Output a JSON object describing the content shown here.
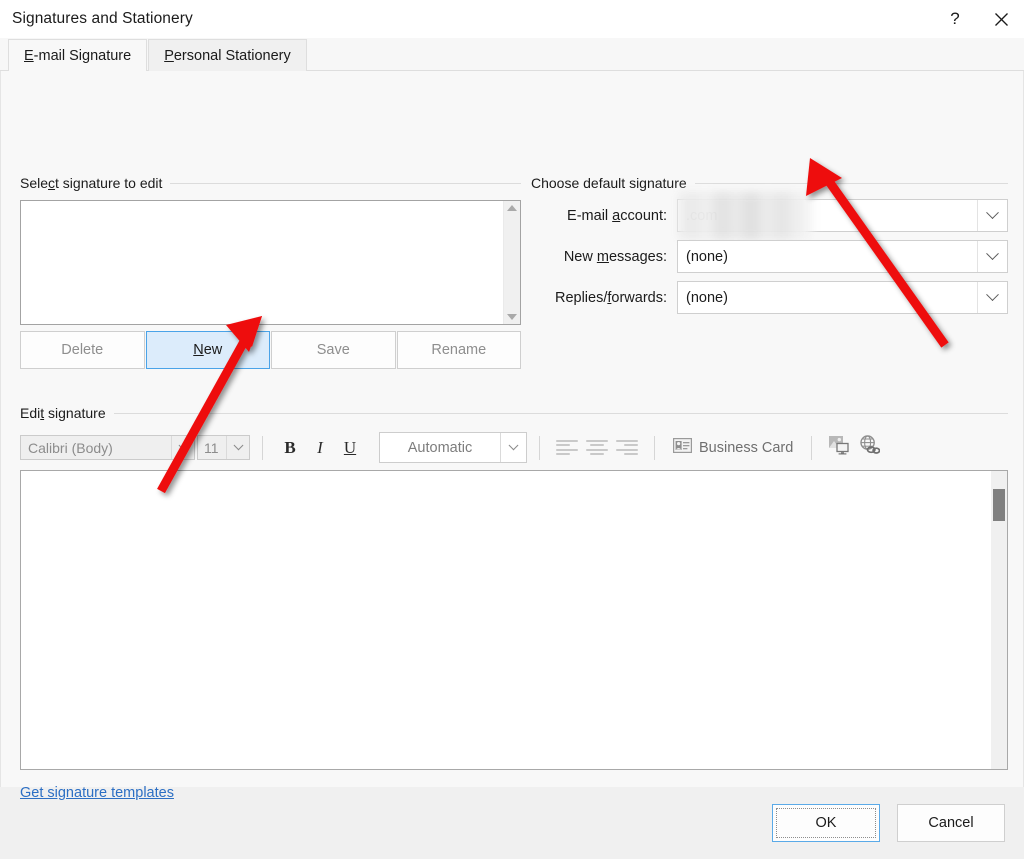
{
  "window": {
    "title": "Signatures and Stationery",
    "help_button": "?",
    "close_button": "✕"
  },
  "tabs": [
    {
      "label_pre": "E",
      "label_acc": "",
      "label": "E-mail Signature",
      "accel": "E",
      "active": true
    },
    {
      "label": "Personal Stationery",
      "accel": "P",
      "active": false
    }
  ],
  "select_signature": {
    "group_label": "Select signature to edit",
    "group_label_accel": "c",
    "list_items": [],
    "buttons": [
      {
        "label": "Delete",
        "state": "disabled"
      },
      {
        "label": "New",
        "accel": "N",
        "state": "highlighted"
      },
      {
        "label": "Save",
        "state": "disabled"
      },
      {
        "label": "Rename",
        "state": "disabled"
      }
    ]
  },
  "default_signature": {
    "group_label": "Choose default signature",
    "fields": [
      {
        "label": "E-mail account:",
        "accel": "a",
        "value": ".com",
        "redacted": true
      },
      {
        "label": "New messages:",
        "accel": "m",
        "value": "(none)",
        "redacted": false
      },
      {
        "label": "Replies/forwards:",
        "accel": "f",
        "value": "(none)",
        "redacted": false
      }
    ]
  },
  "edit_signature": {
    "group_label": "Edit signature",
    "group_label_accel": "t",
    "toolbar": {
      "font_family": "Calibri (Body)",
      "font_size": "11",
      "bold": "B",
      "italic": "I",
      "underline": "U",
      "font_color": "Automatic",
      "align_left_icon": "align-left-icon",
      "align_center_icon": "align-center-icon",
      "align_right_icon": "align-right-icon",
      "business_card_label": "Business Card",
      "business_card_icon": "business-card-icon",
      "insert_picture_icon": "insert-picture-icon",
      "insert_hyperlink_icon": "insert-hyperlink-icon"
    },
    "editor_text": "",
    "templates_link": "Get signature templates"
  },
  "footer": {
    "ok_label": "OK",
    "cancel_label": "Cancel"
  },
  "annotations": {
    "arrow_color": "#ee1111",
    "arrow_1_target": "New button",
    "arrow_2_target": "E-mail account dropdown"
  }
}
